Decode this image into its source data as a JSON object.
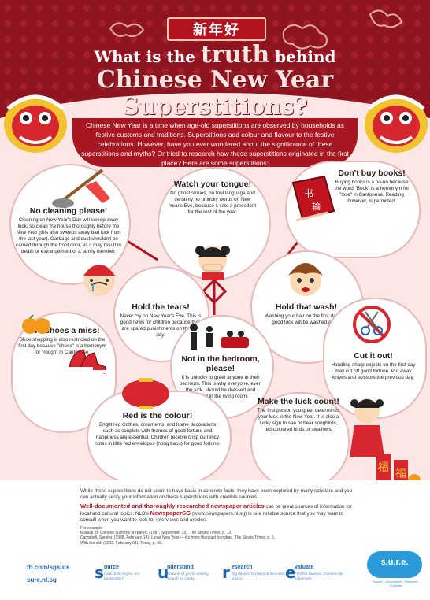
{
  "header": {
    "chinese_greeting": "新年好",
    "title_line1_a": "What is the",
    "title_line1_b": "truth",
    "title_line1_c": "behind",
    "title_line2": "Chinese New Year",
    "title_line3": "Superstitions?"
  },
  "intro": "Chinese New Year is a time when age-old superstitions are observed by households as festive customs and traditions. Superstitions add colour and flavour to the festive celebrations. However, have you ever wondered about the significance of these superstitions and myths? Or tried to research how these superstitions originated in the first place? Here are some superstitions:",
  "superstitions": [
    {
      "title": "No cleaning please!",
      "text": "Cleaning on New Year's Day will sweep away luck, so clean the house thoroughly before the New Year (this also sweeps away bad luck from the last year). Garbage and dust shouldn't be carried through the front door, as it may result in death or estrangement of a family member."
    },
    {
      "title": "Watch your tongue!",
      "text": "No ghost stories, no foul language and certainly no unlucky words on New Year's Eve, because it sets a precedent for the rest of the year."
    },
    {
      "title": "Don't buy books!",
      "text": "Buying books is a no-no because the word \"Book\" is a homonym for \"lose\" in Cantonese. Reading however, is permitted."
    },
    {
      "title": "Hold the tears!",
      "text": "Never cry on New Year's Eve. This is good news for children because they are spared punishments on the first day."
    },
    {
      "title": "Hold that wash!",
      "text": "Washing your hair on the first day and good luck will be washed away."
    },
    {
      "title": "Give shoes a miss!",
      "text": "Shoe shopping is also restricted on the first day because \"shoes\" is a homonym for \"rough\" in Cantonese."
    },
    {
      "title": "Not in the bedroom, please!",
      "text": "It is unlucky to greet anyone in their bedroom. This is why everyone, even the sick, should be dressed and seated in the living room."
    },
    {
      "title": "Cut it out!",
      "text": "Handling sharp objects on the first day may cut off good fortune. Put away knives and scissors the previous day."
    },
    {
      "title": "Red is the colour!",
      "text": "Bright red clothes, ornaments, and home decorations such as couplets with themes of good fortune and happiness are essential. Children receive crisp currency notes in little red envelopes (hong baos) for good fortune."
    },
    {
      "title": "Make the luck count!",
      "text": "The first person you greet determines your luck in the New Year. It is also a lucky sign to see or hear songbirds, red-coloured birds or swallows."
    }
  ],
  "book_glyphs": [
    "书",
    "输"
  ],
  "fu_glyph": "福",
  "footer": {
    "para1": "While these superstitions do not seem to have basis in concrete facts, they have been explored by many scholars and you can actually verify your information on these superstitions with credible sources.",
    "para2_bold": "Well-documented and thoroughly researched newspaper articles",
    "para2_a": " can be great sources of information for local and cultural topics. NLB's ",
    "para2_brand": "NewspaperSG",
    "para2_url": " (www.newspapers.nl.sg)",
    "para2_b": " is one reliable source that you may want to consult when you want to look for interviews and articles.",
    "ref_head": "For example:",
    "refs": [
      "Manual on Chinese customs prepared. (1987, September 15). The Straits Times, p. 12.",
      "Campbell, Sandra. (1988, February 14). Lunar New Year — it's more than just hongbao. The Straits Times, p. 5.",
      "With the old. (2002, February 01). Today, p. 66."
    ],
    "social1": "fb.com/sgsure",
    "social2": "sure.nl.sg"
  },
  "sure": [
    {
      "letter": "s",
      "word": "ource",
      "desc": "Look at its origins. Is it trustworthy?"
    },
    {
      "letter": "u",
      "word": "nderstand",
      "desc": "Know what you're reading. Search for clarity."
    },
    {
      "letter": "r",
      "word": "esearch",
      "desc": "Dig deeper. Go beyond the initial source."
    },
    {
      "letter": "e",
      "word": "valuate",
      "desc": "Find the balance. Exercise fair judgement."
    }
  ],
  "sure_logo": "s.u.r.e.",
  "sure_tagline": "Source · Understand · Research · Evaluate",
  "colors": {
    "header": "#8e1420",
    "accent": "#c0141f",
    "brand_blue": "#1a66b8"
  }
}
